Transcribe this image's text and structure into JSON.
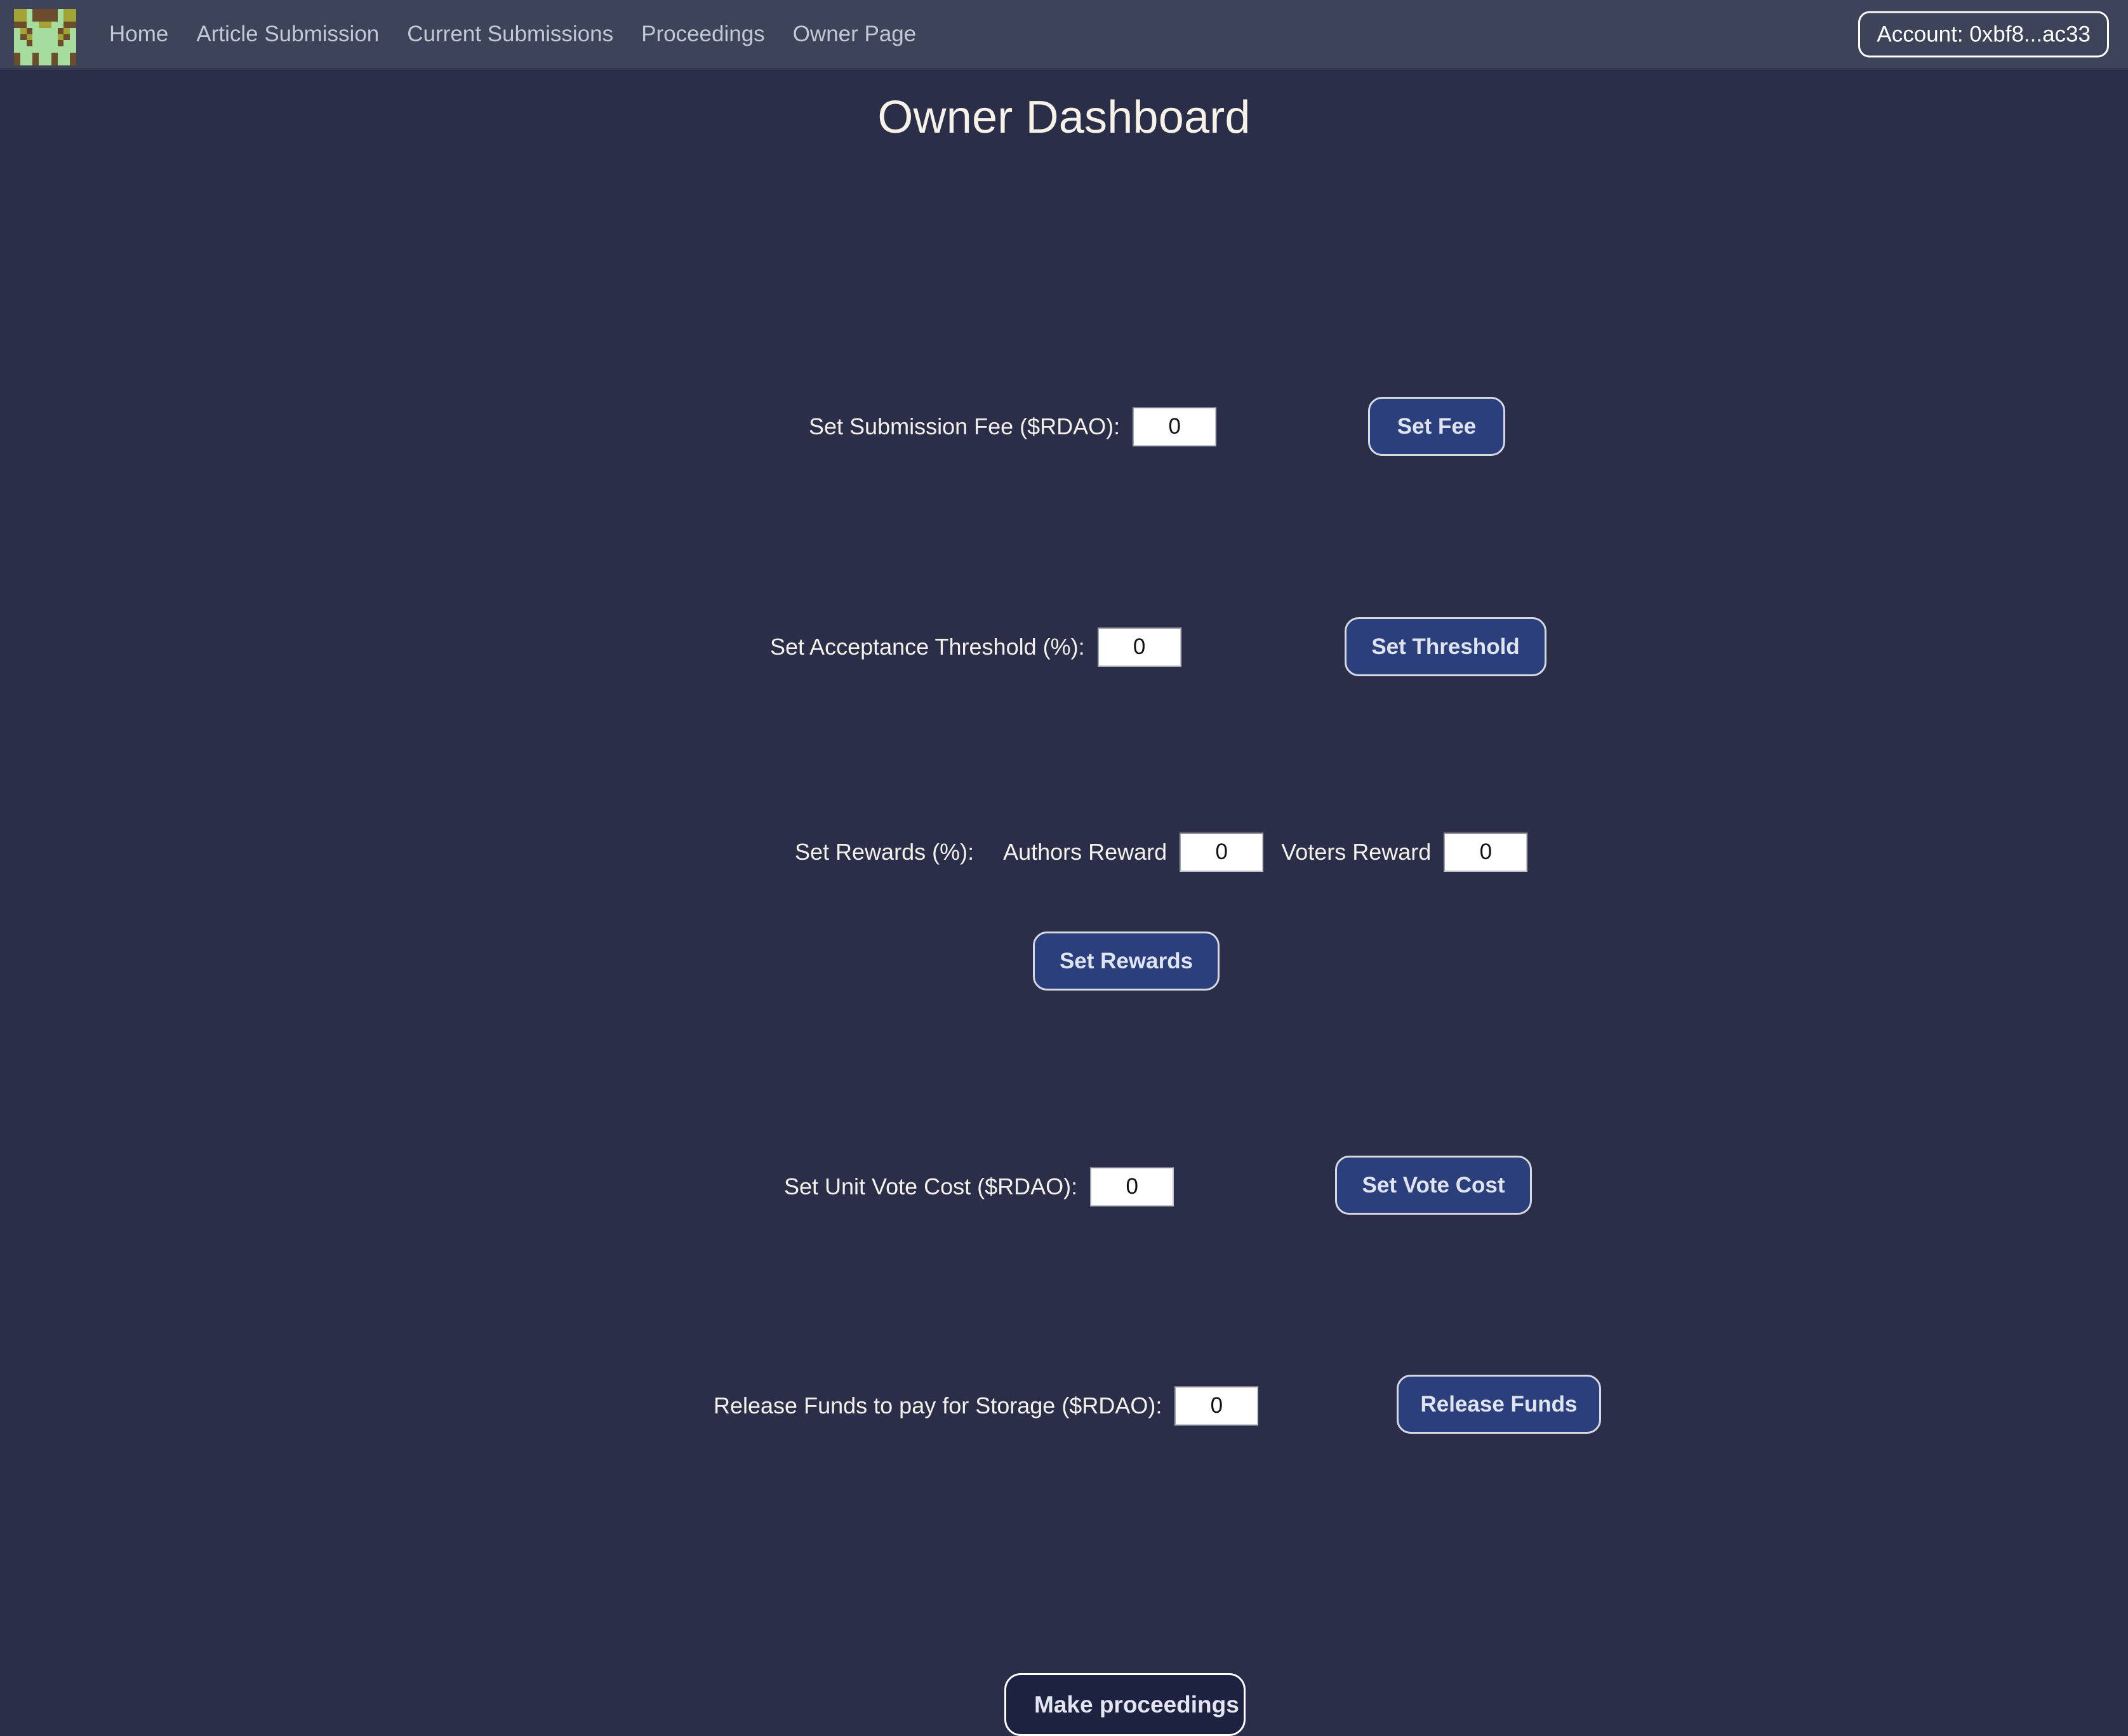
{
  "theme": {
    "page_bg": "#2a2e48",
    "navbar_bg": "#3d4358",
    "title_color": "#f6f2e8",
    "button_bg": "#2b3f7c",
    "button_border": "#d6d9e0",
    "dark_button_bg": "#1d2240",
    "input_bg": "#ffffff"
  },
  "navbar": {
    "logo_name": "pixel-avatar-logo",
    "links": [
      {
        "label": "Home"
      },
      {
        "label": "Article Submission"
      },
      {
        "label": "Current Submissions"
      },
      {
        "label": "Proceedings"
      },
      {
        "label": "Owner Page"
      }
    ],
    "account": {
      "label": "Account: 0xbf8...ac33"
    }
  },
  "page": {
    "title": "Owner Dashboard"
  },
  "form": {
    "submission_fee": {
      "label": "Set Submission Fee ($RDAO):",
      "value": "0",
      "placeholder": "0",
      "button": "Set Fee"
    },
    "acceptance_threshold": {
      "label": "Set Acceptance Threshold (%):",
      "value": "0",
      "placeholder": "0",
      "button": "Set Threshold"
    },
    "rewards": {
      "label": "Set Rewards (%):",
      "authors_label": "Authors Reward",
      "authors_value": "0",
      "authors_placeholder": "0",
      "voters_label": "Voters Reward",
      "voters_value": "0",
      "voters_placeholder": "0",
      "button": "Set Rewards"
    },
    "unit_vote_cost": {
      "label": "Set Unit Vote Cost ($RDAO):",
      "value": "0",
      "placeholder": "0",
      "button": "Set Vote Cost"
    },
    "release_funds": {
      "label": "Release Funds to pay for Storage ($RDAO):",
      "value": "0",
      "placeholder": "0",
      "button": "Release Funds"
    }
  },
  "footer": {
    "make_proceedings_button": "Make proceedings"
  },
  "logo_pixels": [
    [
      "#3d4358",
      "#3d4358",
      "#3d4358",
      "#3d4358",
      "#3d4358",
      "#3d4358",
      "#3d4358",
      "#3d4358",
      "#3d4358",
      "#3d4358"
    ],
    [
      "#a2a235",
      "#a2a235",
      "#a6dc9d",
      "#6b4d2e",
      "#6b4d2e",
      "#6b4d2e",
      "#6b4d2e",
      "#a6dc9d",
      "#a2a235",
      "#a2a235"
    ],
    [
      "#a2a235",
      "#a2a235",
      "#a6dc9d",
      "#6b4d2e",
      "#6b4d2e",
      "#6b4d2e",
      "#6b4d2e",
      "#a6dc9d",
      "#a2a235",
      "#a2a235"
    ],
    [
      "#6b4d2e",
      "#6b4d2e",
      "#a6dc9d",
      "#a6dc9d",
      "#a2a235",
      "#a2a235",
      "#a6dc9d",
      "#a6dc9d",
      "#6b4d2e",
      "#6b4d2e"
    ],
    [
      "#a6dc9d",
      "#a2a235",
      "#6b4d2e",
      "#a6dc9d",
      "#a6dc9d",
      "#a6dc9d",
      "#a6dc9d",
      "#6b4d2e",
      "#a2a235",
      "#a6dc9d"
    ],
    [
      "#a6dc9d",
      "#6b4d2e",
      "#a2a235",
      "#a6dc9d",
      "#a6dc9d",
      "#a6dc9d",
      "#a6dc9d",
      "#a2a235",
      "#6b4d2e",
      "#a6dc9d"
    ],
    [
      "#a6dc9d",
      "#a6dc9d",
      "#6b4d2e",
      "#a6dc9d",
      "#a6dc9d",
      "#a6dc9d",
      "#a6dc9d",
      "#6b4d2e",
      "#a6dc9d",
      "#a6dc9d"
    ],
    [
      "#a6dc9d",
      "#a6dc9d",
      "#a6dc9d",
      "#a6dc9d",
      "#a6dc9d",
      "#a6dc9d",
      "#a6dc9d",
      "#a6dc9d",
      "#a6dc9d",
      "#a6dc9d"
    ],
    [
      "#6b4d2e",
      "#a6dc9d",
      "#a6dc9d",
      "#6b4d2e",
      "#a6dc9d",
      "#a6dc9d",
      "#6b4d2e",
      "#a6dc9d",
      "#a6dc9d",
      "#6b4d2e"
    ],
    [
      "#6b4d2e",
      "#a6dc9d",
      "#a6dc9d",
      "#6b4d2e",
      "#a6dc9d",
      "#a6dc9d",
      "#6b4d2e",
      "#a6dc9d",
      "#a6dc9d",
      "#6b4d2e"
    ]
  ]
}
